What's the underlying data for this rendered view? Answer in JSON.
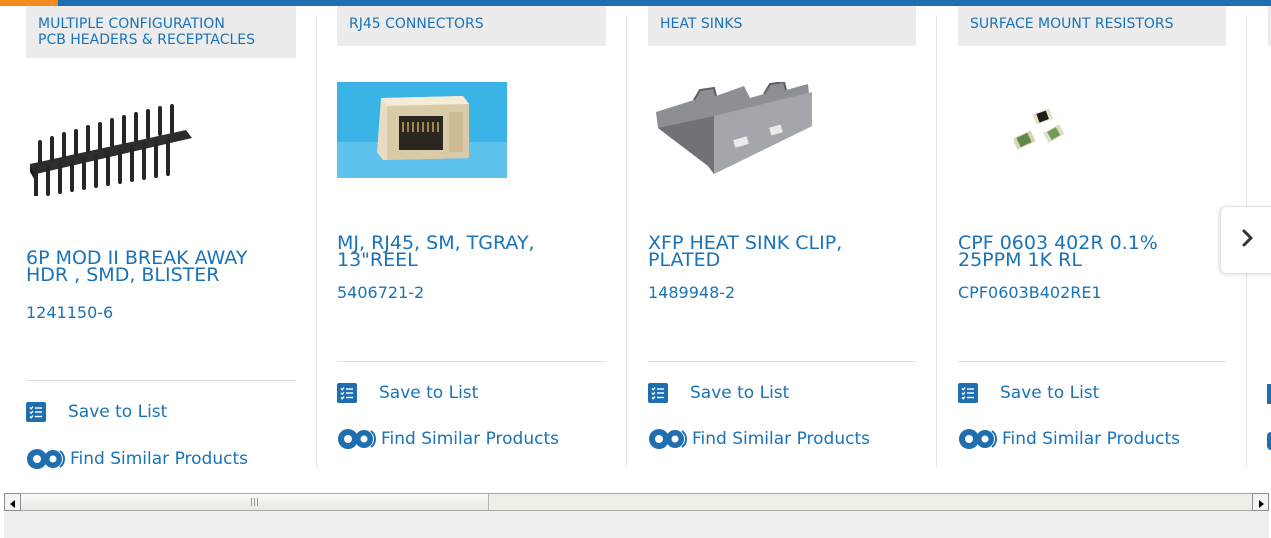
{
  "cards": [
    {
      "category_lines": [
        "MULTIPLE CONFIGURATION",
        "PCB HEADERS & RECEPTACLES"
      ],
      "title_lines": [
        "6P MOD II BREAK AWAY",
        "HDR , SMD, BLISTER"
      ],
      "part_number": "1241150-6",
      "image": "pin-header-image",
      "save_label": "Save to List",
      "similar_label": "Find Similar Products"
    },
    {
      "category_lines": [
        "RJ45 CONNECTORS"
      ],
      "title_lines": [
        "MJ, RJ45, SM, TGRAY,",
        "13\"REEL"
      ],
      "part_number": "5406721-2",
      "image": "rj45-connector-image",
      "save_label": "Save to List",
      "similar_label": "Find Similar Products"
    },
    {
      "category_lines": [
        "HEAT SINKS"
      ],
      "title_lines": [
        "XFP HEAT SINK CLIP,",
        "PLATED"
      ],
      "part_number": "1489948-2",
      "image": "heat-sink-clip-image",
      "save_label": "Save to List",
      "similar_label": "Find Similar Products"
    },
    {
      "category_lines": [
        "SURFACE MOUNT RESISTORS"
      ],
      "title_lines": [
        "CPF 0603 402R 0.1%",
        "25PPM 1K RL"
      ],
      "part_number": "CPF0603B402RE1",
      "image": "smd-resistor-image",
      "save_label": "Save to List",
      "similar_label": "Find Similar Products"
    }
  ],
  "next_button": {
    "icon": "chevron-right-icon"
  },
  "scrollbar": {
    "left_icon": "arrow-left-icon",
    "right_icon": "arrow-right-icon"
  },
  "colors": {
    "link": "#1a73b8",
    "accent": "#f28c1e",
    "brand": "#1f6fb0"
  }
}
